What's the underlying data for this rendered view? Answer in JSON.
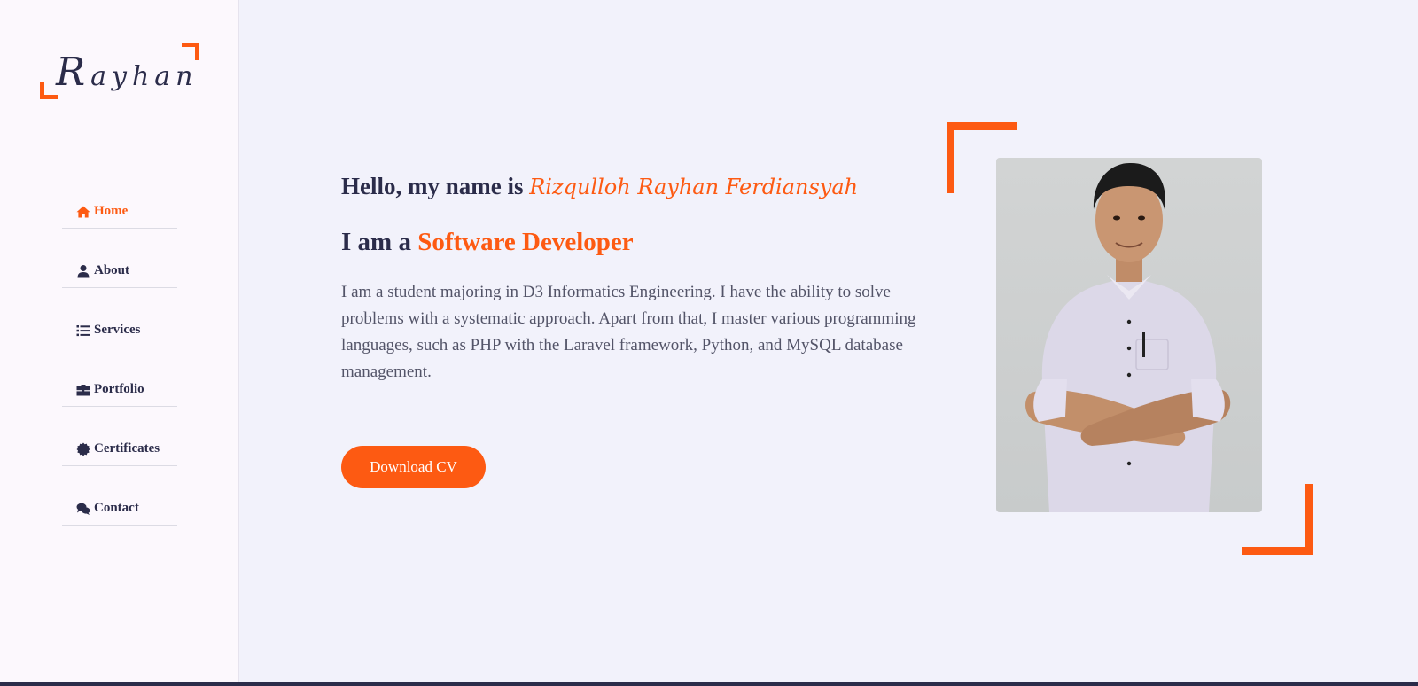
{
  "sidebar": {
    "logo": {
      "cap": "R",
      "rest": "ayhan"
    },
    "items": [
      {
        "label": "Home",
        "icon": "home-icon"
      },
      {
        "label": "About",
        "icon": "user-icon"
      },
      {
        "label": "Services",
        "icon": "list-icon"
      },
      {
        "label": "Portfolio",
        "icon": "briefcase-icon"
      },
      {
        "label": "Certificates",
        "icon": "certificate-icon"
      },
      {
        "label": "Contact",
        "icon": "comments-icon"
      }
    ]
  },
  "hero": {
    "greeting": "Hello, my name is",
    "name": "Rizqulloh Rayhan Ferdiansyah",
    "role_prefix": "I am a",
    "role": "Software Developer",
    "bio": "I am a student majoring in D3 Informatics Engineering. I have the ability to solve problems with a systematic approach. Apart from that, I master various programming languages, such as PHP with the Laravel framework, Python, and MySQL database management.",
    "cv_button": "Download CV"
  },
  "colors": {
    "accent": "#fd5a12",
    "text_dark": "#2b2c4a",
    "background": "#f2f2fb",
    "sidebar_bg": "#fcf8fd"
  }
}
